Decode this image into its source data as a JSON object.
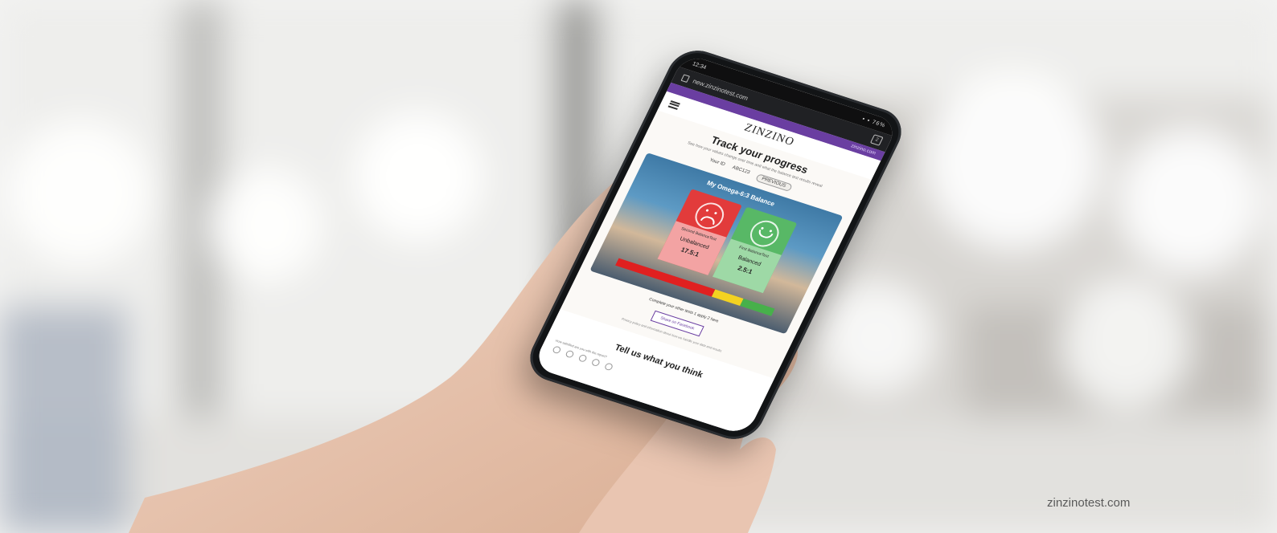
{
  "phone": {
    "status": {
      "time": "12:34",
      "indicators": "▪ ▪ 76%"
    },
    "browser": {
      "url": "new.zinzinotest.com",
      "tabs_count": "2"
    },
    "topbar": {
      "link": "zinzino.com"
    },
    "site": {
      "logo": "ZINZINO",
      "title": "Track your progress",
      "subtitle": "See how your values change over time and what the balance test results reveal",
      "tabs": [
        "Your ID",
        "ABC123",
        "PREVIOUS"
      ],
      "card": {
        "title": "My Omega-6:3 Balance",
        "before": {
          "label": "Second BalanceTest",
          "date": "02.02.2023",
          "state": "Unbalanced",
          "ratio": "17.5:1"
        },
        "after": {
          "label": "First BalanceTest",
          "date": "01.01.2023",
          "state": "Balanced",
          "ratio": "2.5:1"
        }
      },
      "complete_text": "Complete your other tests 1 apply 2 here",
      "cta": "Share on Facebook",
      "fine_print": "Privacy policy and information about how we handle your data and results",
      "section2_title": "Tell us what you think",
      "section2_question": "How satisfied are you with the report?"
    }
  },
  "watermark": "zinzinotest.com",
  "colors": {
    "accent": "#6a3ea1",
    "unbalanced": "#e23b3b",
    "balanced": "#58b866"
  },
  "icons": [
    "hamburger-icon",
    "lock-icon",
    "tabs-icon",
    "sad-face-icon",
    "happy-face-icon"
  ]
}
